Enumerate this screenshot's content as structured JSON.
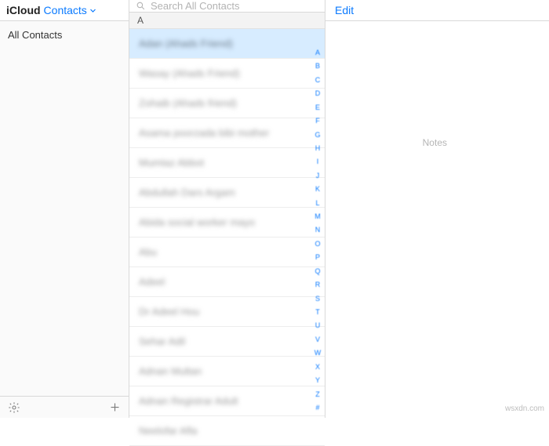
{
  "header": {
    "brand": "iCloud",
    "section": "Contacts"
  },
  "sidebar": {
    "groups": [
      "All Contacts"
    ]
  },
  "search": {
    "placeholder": "Search All Contacts"
  },
  "list": {
    "section_letter": "A",
    "contacts": [
      {
        "display": "Adan (Ahads Friend)",
        "selected": true
      },
      {
        "display": "Wasay (Ahads Friend)",
        "selected": false
      },
      {
        "display": "Zohaib (Ahads friend)",
        "selected": false
      },
      {
        "display": "Asama poorzada bibi mother",
        "selected": false
      },
      {
        "display": "Mumtaz Abbot",
        "selected": false
      },
      {
        "display": "Abdullah Dars Argam",
        "selected": false
      },
      {
        "display": "Abida social worker mayo",
        "selected": false
      },
      {
        "display": "Abu",
        "selected": false
      },
      {
        "display": "Adeel",
        "selected": false
      },
      {
        "display": "Dr Adeel Hou",
        "selected": false
      },
      {
        "display": "Sehar Adil",
        "selected": false
      },
      {
        "display": "Adnan Multan",
        "selected": false
      },
      {
        "display": "Adnan Registrar Adult",
        "selected": false
      },
      {
        "display": "Neelofar Afla",
        "selected": false
      }
    ]
  },
  "index_letters": [
    "A",
    "B",
    "C",
    "D",
    "E",
    "F",
    "G",
    "H",
    "I",
    "J",
    "K",
    "L",
    "M",
    "N",
    "O",
    "P",
    "Q",
    "R",
    "S",
    "T",
    "U",
    "V",
    "W",
    "X",
    "Y",
    "Z",
    "#"
  ],
  "detail": {
    "edit_label": "Edit",
    "notes_label": "Notes"
  },
  "watermark": "wsxdn.com"
}
